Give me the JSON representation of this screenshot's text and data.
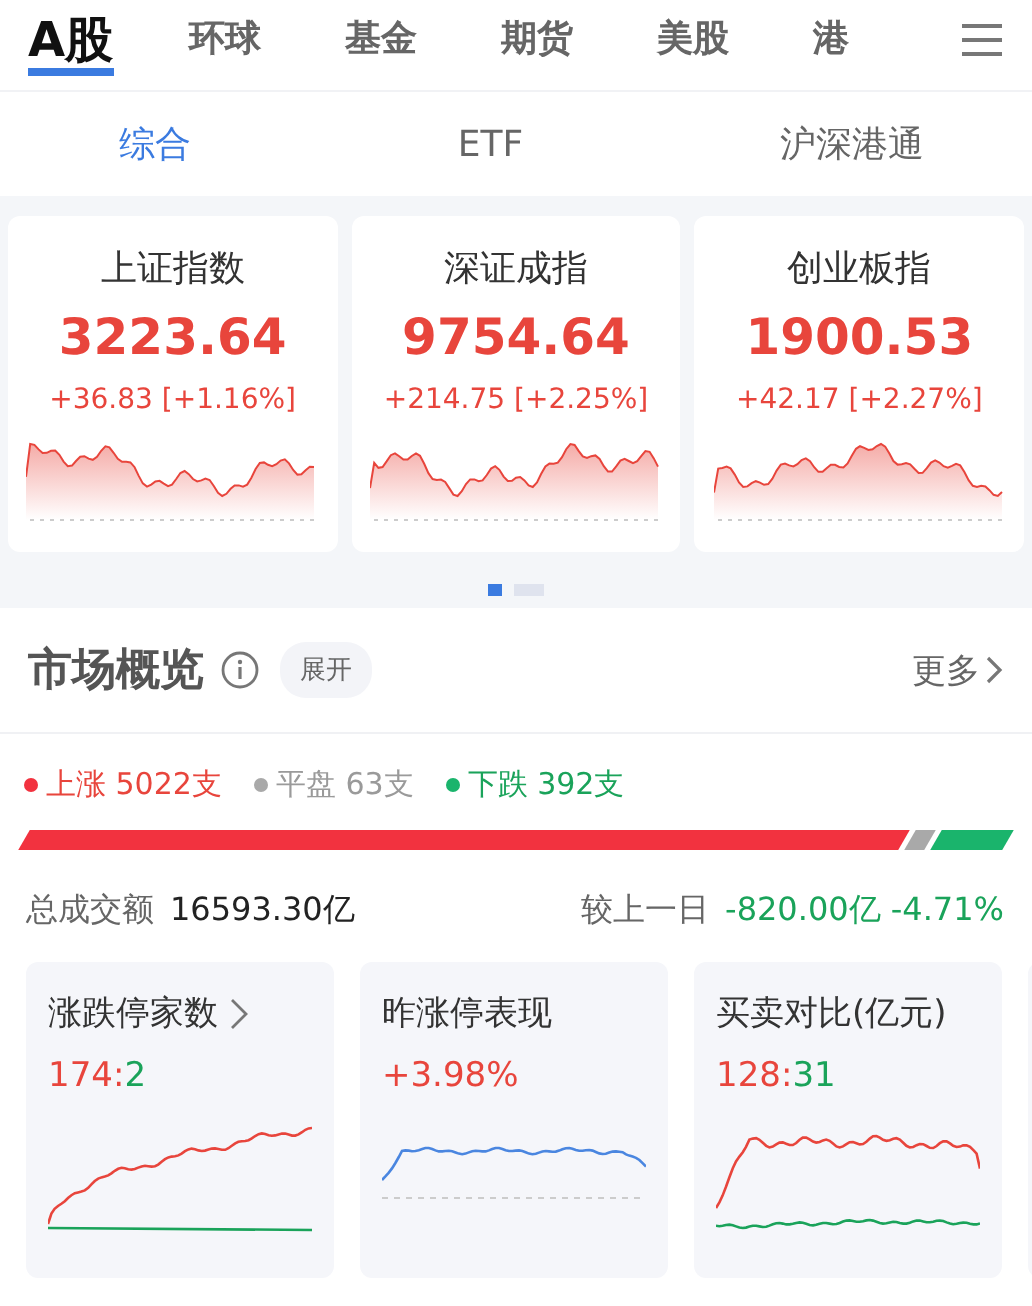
{
  "market_tabs": [
    {
      "label": "A股",
      "selected": true
    },
    {
      "label": "环球",
      "selected": false
    },
    {
      "label": "基金",
      "selected": false
    },
    {
      "label": "期货",
      "selected": false
    },
    {
      "label": "美股",
      "selected": false
    },
    {
      "label": "港",
      "selected": false
    }
  ],
  "sub_tabs": [
    {
      "label": "综合",
      "selected": true
    },
    {
      "label": "ETF",
      "selected": false
    },
    {
      "label": "沪深港通",
      "selected": false
    }
  ],
  "indices": [
    {
      "name": "上证指数",
      "value": "3223.64",
      "change": "+36.83 [+1.16%]",
      "kind": "up"
    },
    {
      "name": "深证成指",
      "value": "9754.64",
      "change": "+214.75 [+2.25%]",
      "kind": "up"
    },
    {
      "name": "创业板指",
      "value": "1900.53",
      "change": "+42.17 [+2.27%]",
      "kind": "up"
    }
  ],
  "pager": [
    {
      "selected": true
    },
    {
      "selected": false
    }
  ],
  "overview": {
    "title": "市场概览",
    "expand": "展开",
    "more": "更多",
    "breadth": [
      {
        "kind": "up",
        "label": "上涨 5022支"
      },
      {
        "kind": "flat",
        "label": "平盘 63支"
      },
      {
        "kind": "down",
        "label": "下跌 392支"
      }
    ],
    "turnover_label": "总成交额",
    "turnover": "16593.30亿",
    "compare_label": "较上一日",
    "compare": {
      "text": "-820.00亿 -4.71%",
      "kind": "down"
    }
  },
  "stat_cards": [
    {
      "title": "涨跌停家数",
      "link": true,
      "parts": [
        {
          "text": "174:",
          "kind": "up"
        },
        {
          "text": "2",
          "kind": "down"
        }
      ],
      "kind": "updown"
    },
    {
      "title": "昨涨停表现",
      "link": false,
      "parts": [
        {
          "text": "+3.98%",
          "kind": "up"
        }
      ],
      "kind": "perf"
    },
    {
      "title": "买卖对比(亿元)",
      "link": false,
      "parts": [
        {
          "text": "128:",
          "kind": "up"
        },
        {
          "text": "31",
          "kind": "down"
        }
      ],
      "kind": "buysell"
    }
  ]
}
